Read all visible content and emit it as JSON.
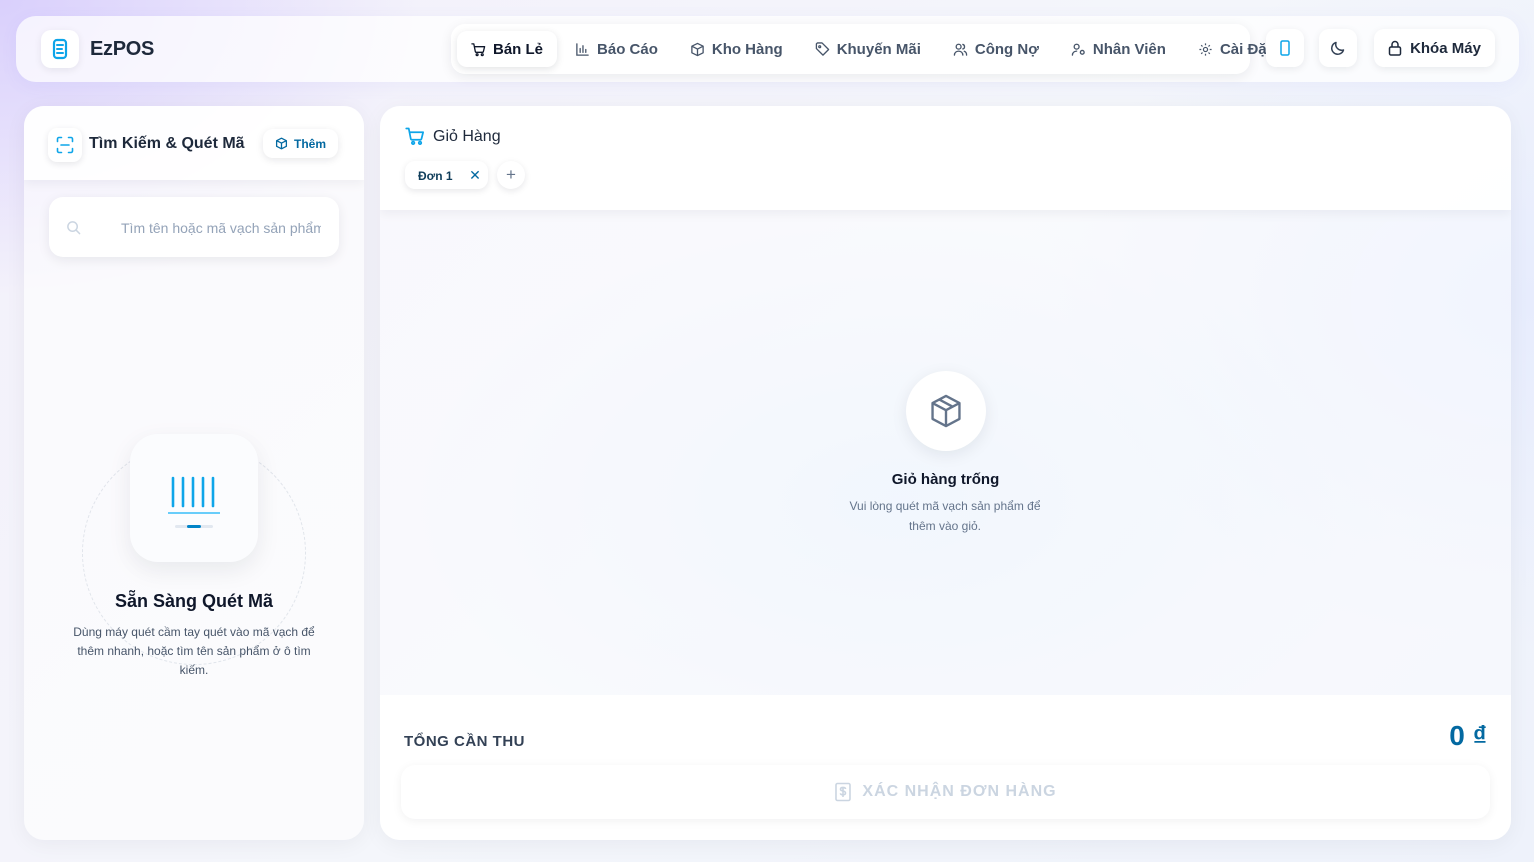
{
  "app": {
    "name": "EzPOS"
  },
  "nav": {
    "items": [
      {
        "label": "Bán Lẻ",
        "icon": "cart-icon",
        "active": true
      },
      {
        "label": "Báo Cáo",
        "icon": "bar-chart-icon",
        "active": false
      },
      {
        "label": "Kho Hàng",
        "icon": "box-icon",
        "active": false
      },
      {
        "label": "Khuyến Mãi",
        "icon": "tag-icon",
        "active": false
      },
      {
        "label": "Công Nợ",
        "icon": "users-icon",
        "active": false
      },
      {
        "label": "Nhân Viên",
        "icon": "user-key-icon",
        "active": false
      },
      {
        "label": "Cài Đặt",
        "icon": "gear-icon",
        "active": false
      }
    ],
    "lock_label": "Khóa Máy"
  },
  "search_panel": {
    "title": "Tìm Kiếm & Quét Mã",
    "add_label": "Thêm",
    "placeholder": "Tìm tên hoặc mã vạch sản phẩm",
    "ready_title": "Sẵn Sàng Quét Mã",
    "ready_desc": "Dùng máy quét cầm tay quét vào mã vạch để thêm nhanh, hoặc tìm tên sản phẩm ở ô tìm kiếm."
  },
  "cart": {
    "title": "Giỏ Hàng",
    "order_tab": "Đơn 1",
    "empty_title": "Giỏ hàng trống",
    "empty_desc": "Vui lòng quét mã vạch sản phẩm để thêm vào giỏ.",
    "total_label": "TỔNG CẦN THU",
    "total_value": "0 ₫",
    "confirm_label": "XÁC NHẬN ĐƠN HÀNG"
  },
  "colors": {
    "accent": "#0ea5e9",
    "accent_dark": "#0369a1",
    "text": "#1e293b",
    "muted": "#64748b",
    "disabled": "#cbd5e1"
  }
}
